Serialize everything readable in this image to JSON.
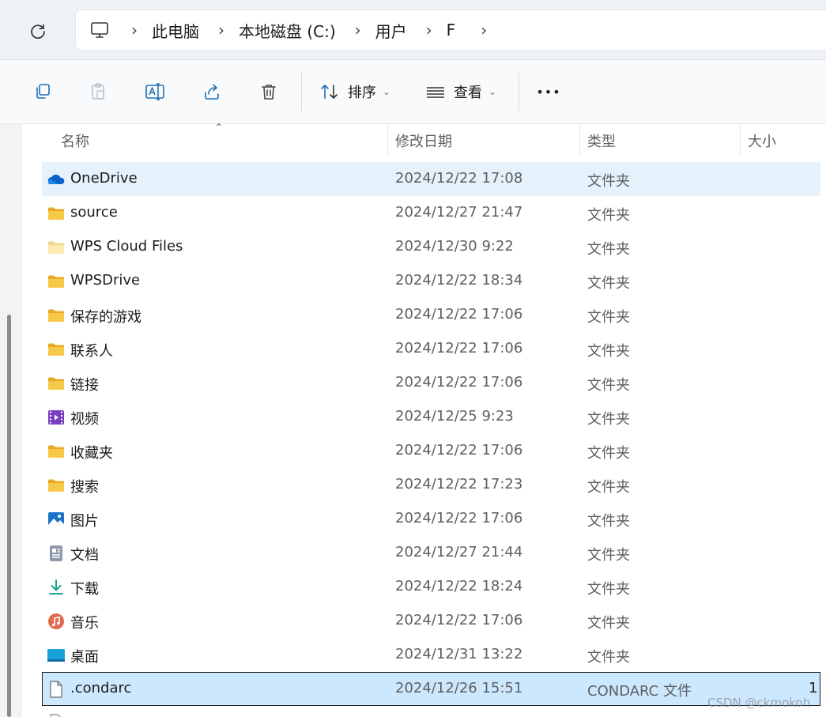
{
  "breadcrumb": [
    "此电脑",
    "本地磁盘 (C:)",
    "用户",
    "F"
  ],
  "toolbar": {
    "sort_label": "排序",
    "view_label": "查看",
    "more_label": "•••"
  },
  "columns": {
    "name": "名称",
    "date": "修改日期",
    "type": "类型",
    "size": "大小"
  },
  "files": [
    {
      "name": "OneDrive",
      "date": "2024/12/22 17:08",
      "type": "文件夹",
      "size": "",
      "icon": "onedrive-icon"
    },
    {
      "name": "source",
      "date": "2024/12/27 21:47",
      "type": "文件夹",
      "size": "",
      "icon": "folder-icon"
    },
    {
      "name": "WPS Cloud Files",
      "date": "2024/12/30 9:22",
      "type": "文件夹",
      "size": "",
      "icon": "folder-light-icon"
    },
    {
      "name": "WPSDrive",
      "date": "2024/12/22 18:34",
      "type": "文件夹",
      "size": "",
      "icon": "folder-icon"
    },
    {
      "name": "保存的游戏",
      "date": "2024/12/22 17:06",
      "type": "文件夹",
      "size": "",
      "icon": "folder-icon"
    },
    {
      "name": "联系人",
      "date": "2024/12/22 17:06",
      "type": "文件夹",
      "size": "",
      "icon": "folder-icon"
    },
    {
      "name": "链接",
      "date": "2024/12/22 17:06",
      "type": "文件夹",
      "size": "",
      "icon": "folder-icon"
    },
    {
      "name": "视频",
      "date": "2024/12/25 9:23",
      "type": "文件夹",
      "size": "",
      "icon": "video-folder-icon"
    },
    {
      "name": "收藏夹",
      "date": "2024/12/22 17:06",
      "type": "文件夹",
      "size": "",
      "icon": "folder-icon"
    },
    {
      "name": "搜索",
      "date": "2024/12/22 17:23",
      "type": "文件夹",
      "size": "",
      "icon": "folder-icon"
    },
    {
      "name": "图片",
      "date": "2024/12/22 17:06",
      "type": "文件夹",
      "size": "",
      "icon": "pictures-icon"
    },
    {
      "name": "文档",
      "date": "2024/12/27 21:44",
      "type": "文件夹",
      "size": "",
      "icon": "documents-icon"
    },
    {
      "name": "下载",
      "date": "2024/12/22 18:24",
      "type": "文件夹",
      "size": "",
      "icon": "download-icon"
    },
    {
      "name": "音乐",
      "date": "2024/12/22 17:06",
      "type": "文件夹",
      "size": "",
      "icon": "music-icon"
    },
    {
      "name": "桌面",
      "date": "2024/12/31 13:22",
      "type": "文件夹",
      "size": "",
      "icon": "desktop-icon"
    },
    {
      "name": ".condarc",
      "date": "2024/12/26 15:51",
      "type": "CONDARC 文件",
      "size": "1",
      "icon": "file-icon"
    }
  ],
  "watermark": "CSDN @ckmokoh",
  "colors": {
    "folder": "#f7c948",
    "hover_row": "#e5f1fb",
    "selected_row": "#cce8ff",
    "accent": "#0067c0"
  }
}
